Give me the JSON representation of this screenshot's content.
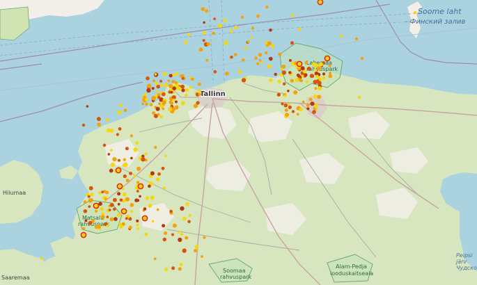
{
  "map": {
    "colors": {
      "water": "#aad3df",
      "land": "#f2efe9",
      "forest": "#cfe3b3",
      "park_fill": "#c4e2b8",
      "park_stroke": "#6aa87a",
      "border": "#9c8ab6",
      "road_major": "#c9a3a3",
      "road_minor": "#a9a9a9",
      "city_area": "#d9d0c9"
    },
    "labels": {
      "gulf_et": "Soome laht",
      "gulf_ru": "- Финский залив",
      "city": "Tallinn",
      "island_hiiumaa": "Hiiumaa",
      "island_saaremaa": "Saaremaa",
      "park_lahemaa_1": "Lahemaa",
      "park_lahemaa_2": "rahvuspark",
      "park_matsalu_1": "Matsalu",
      "park_matsalu_2": "rahvuspark",
      "park_soomaa_1": "Soomaa",
      "park_soomaa_2": "rahvuspark",
      "park_alam_1": "Alam-Pedja",
      "park_alam_2": "looduskaitseala",
      "lake_1": "Peipsi",
      "lake_2": "järv",
      "lake_3": "Чудско"
    },
    "marker_colors": {
      "recent": "#f5d60f",
      "hour_old": "#f2a20c",
      "older": "#d4570d",
      "oldest": "#b53a0a",
      "highlight_ring": "#e0201c"
    }
  }
}
